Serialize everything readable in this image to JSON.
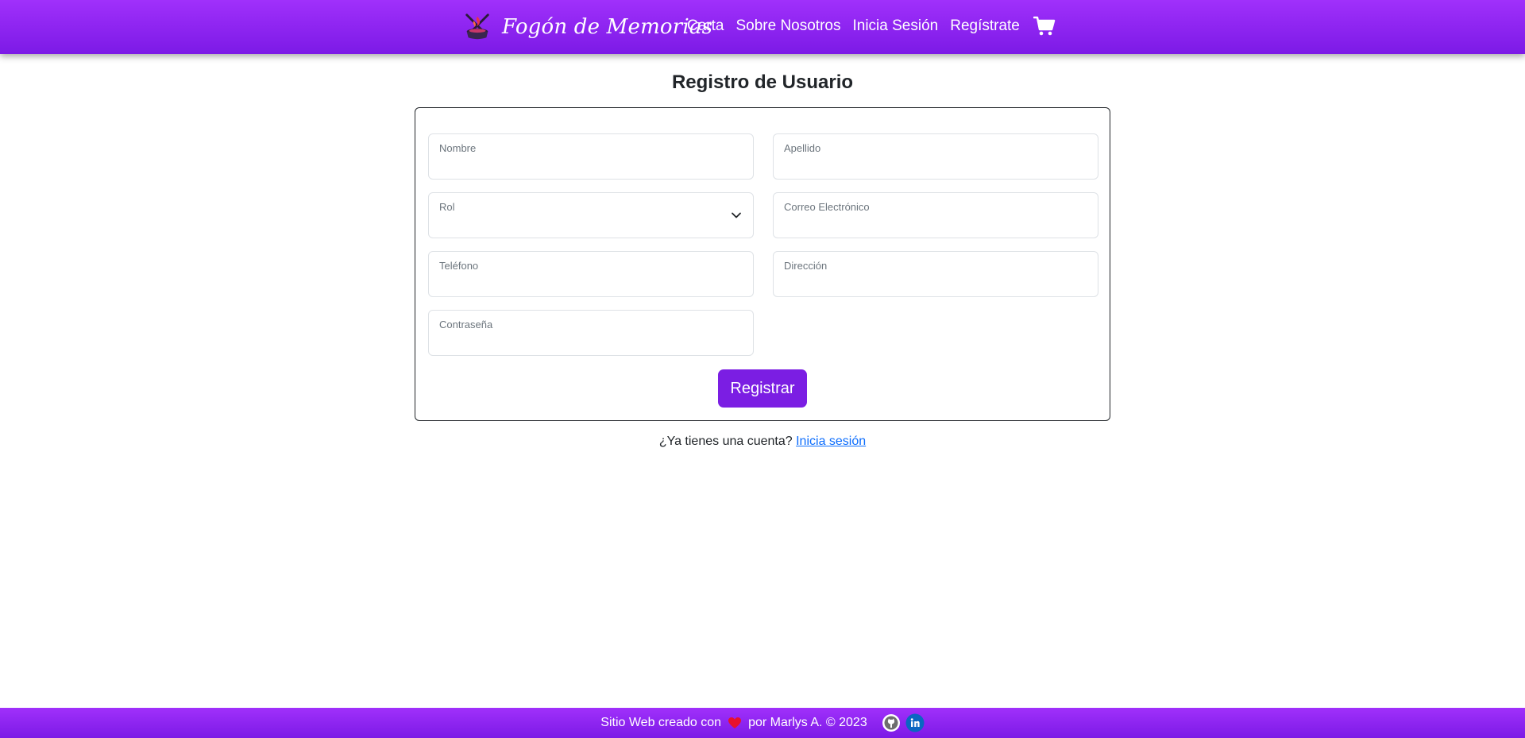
{
  "header": {
    "brand_name": "Fogón de Memorias",
    "nav": [
      {
        "label": "Carta"
      },
      {
        "label": "Sobre Nosotros"
      },
      {
        "label": "Inicia Sesión"
      },
      {
        "label": "Regístrate"
      }
    ],
    "cart_icon": "shopping-cart-icon"
  },
  "main": {
    "title": "Registro de Usuario",
    "form": {
      "fields": {
        "nombre": {
          "label": "Nombre",
          "value": ""
        },
        "apellido": {
          "label": "Apellido",
          "value": ""
        },
        "rol": {
          "label": "Rol",
          "value": ""
        },
        "correo": {
          "label": "Correo Electrónico",
          "value": ""
        },
        "telefono": {
          "label": "Teléfono",
          "value": ""
        },
        "direccion": {
          "label": "Dirección",
          "value": ""
        },
        "contrasena": {
          "label": "Contraseña",
          "value": ""
        }
      },
      "submit_label": "Registrar"
    },
    "login_prompt": {
      "text": "¿Ya tienes una cuenta?",
      "link_label": "Inicia sesión"
    }
  },
  "footer": {
    "text_before": "Sitio Web creado con",
    "text_after": "por Marlys A. © 2023",
    "icons": [
      "heart-icon",
      "github-icon",
      "linkedin-icon"
    ]
  },
  "colors": {
    "brand_purple": "#8a24f0",
    "button_purple": "#7b1ee3",
    "link_blue": "#0d6efd"
  }
}
